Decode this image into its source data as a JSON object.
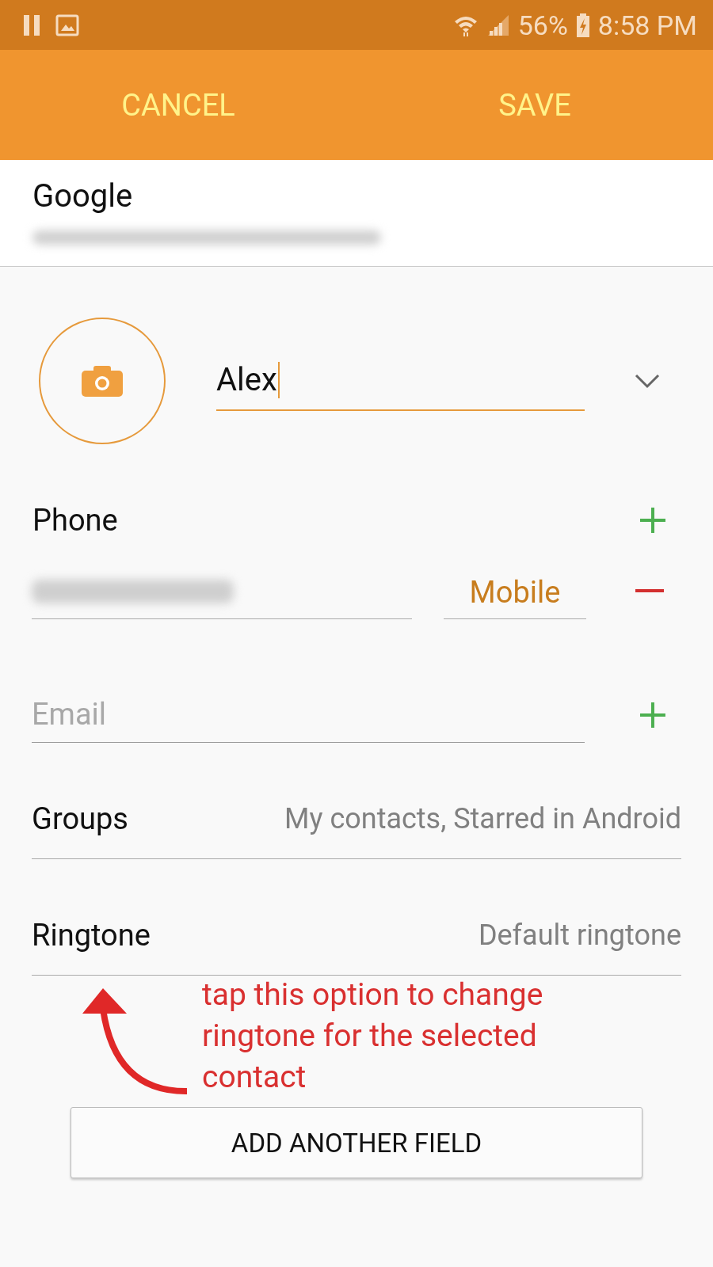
{
  "status_bar": {
    "battery": "56%",
    "time": "8:58 PM"
  },
  "action_bar": {
    "buttons": [
      "CANCEL",
      "SAVE"
    ]
  },
  "account": {
    "name": "Google"
  },
  "contact_name": {
    "value": "Alex",
    "focused": true
  },
  "phone": {
    "label": "Phone",
    "type": "Mobile"
  },
  "email": {
    "placeholder": "Email"
  },
  "groups": {
    "label": "Groups",
    "value": "My contacts, Starred in Android"
  },
  "ringtone": {
    "label": "Ringtone",
    "value": "Default ringtone"
  },
  "annotation": {
    "text": "tap this option to change ringtone for the selected contact"
  },
  "add_field_button": "ADD ANOTHER FIELD"
}
